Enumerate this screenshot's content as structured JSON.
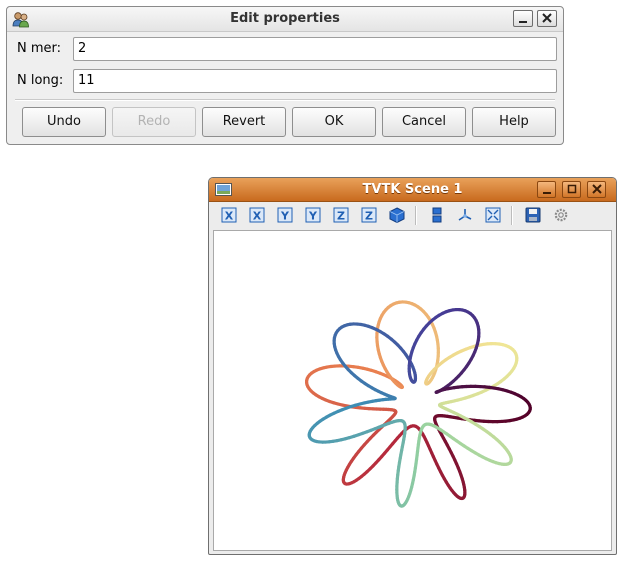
{
  "dialog": {
    "title": "Edit properties",
    "fields": [
      {
        "label": "N mer:",
        "value": "2"
      },
      {
        "label": "N long:",
        "value": "11"
      }
    ],
    "buttons": {
      "undo": "Undo",
      "redo": "Redo",
      "revert": "Revert",
      "ok": "OK",
      "cancel": "Cancel",
      "help": "Help"
    },
    "redo_enabled": false
  },
  "scene": {
    "title": "TVTK Scene 1",
    "toolbar": [
      {
        "name": "view-minus-x-icon",
        "glyph": "X"
      },
      {
        "name": "view-plus-x-icon",
        "glyph": "X"
      },
      {
        "name": "view-minus-y-icon",
        "glyph": "Y"
      },
      {
        "name": "view-plus-y-icon",
        "glyph": "Y"
      },
      {
        "name": "view-minus-z-icon",
        "glyph": "Z"
      },
      {
        "name": "view-plus-z-icon",
        "glyph": "Z"
      },
      {
        "name": "isometric-view-icon"
      },
      {
        "name": "parallel-projection-icon"
      },
      {
        "name": "axes-toggle-icon"
      },
      {
        "name": "full-screen-icon"
      },
      {
        "name": "save-icon"
      },
      {
        "name": "configure-icon"
      }
    ],
    "curve": "torus knot (colored tube)"
  },
  "colors": {
    "scene_titlebar": "#d07a2c",
    "toolbar_icon_blue": "#1f5fb3"
  }
}
